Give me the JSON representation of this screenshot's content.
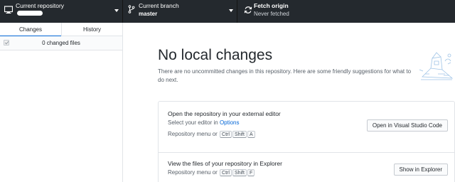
{
  "toolbar": {
    "repo": {
      "title": "Current repository",
      "value_redacted": true,
      "icon": "monitor-icon"
    },
    "branch": {
      "title": "Current branch",
      "value": "master",
      "icon": "git-branch-icon"
    },
    "fetch": {
      "title": "Fetch origin",
      "status": "Never fetched",
      "icon": "sync-icon"
    }
  },
  "sidebar": {
    "tabs": [
      {
        "label": "Changes",
        "active": true
      },
      {
        "label": "History",
        "active": false
      }
    ],
    "changes_count": "0 changed files"
  },
  "main": {
    "heading": "No local changes",
    "subtitle": "There are no uncommitted changes in this repository. Here are some friendly suggestions for what to do next.",
    "cards": [
      {
        "title": "Open the repository in your external editor",
        "desc_prefix": "Select your editor in ",
        "desc_link": "Options",
        "shortcut_prefix": "Repository menu or",
        "keys": [
          "Ctrl",
          "Shift",
          "A"
        ],
        "button": "Open in Visual Studio Code"
      },
      {
        "title": "View the files of your repository in Explorer",
        "shortcut_prefix": "Repository menu or",
        "keys": [
          "Ctrl",
          "Shift",
          "F"
        ],
        "button": "Show in Explorer"
      }
    ]
  },
  "colors": {
    "toolbar_bg": "#24292e",
    "accent": "#0366d6",
    "border": "#e1e4e8"
  }
}
